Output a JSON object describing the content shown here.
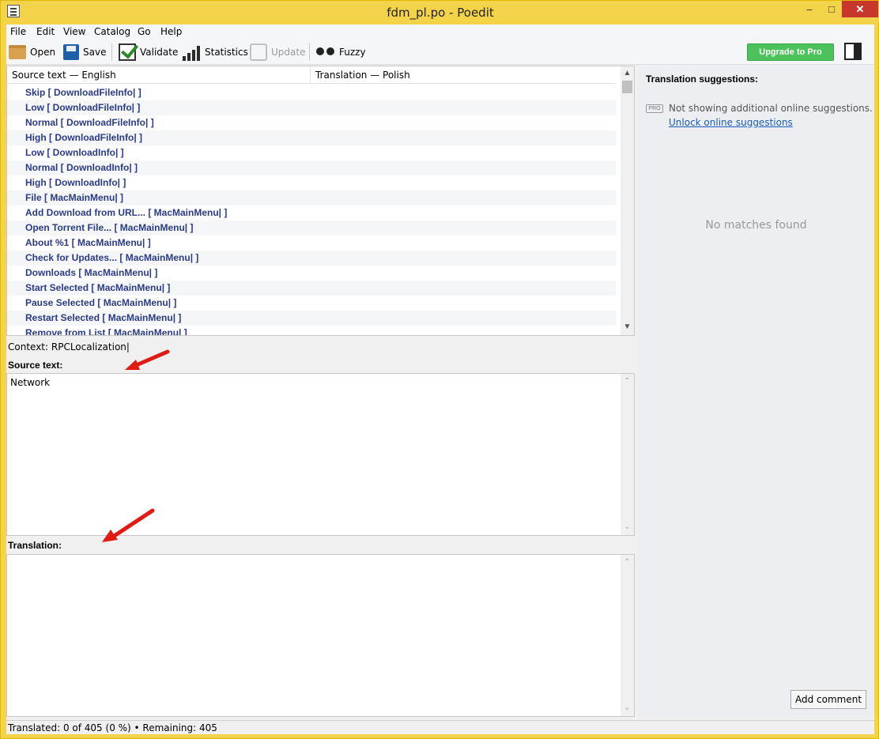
{
  "window": {
    "title": "fdm_pl.po - Poedit"
  },
  "menu": [
    "File",
    "Edit",
    "View",
    "Catalog",
    "Go",
    "Help"
  ],
  "toolbar": {
    "open": "Open",
    "save": "Save",
    "validate": "Validate",
    "statistics": "Statistics",
    "update": "Update",
    "fuzzy": "Fuzzy",
    "upgrade": "Upgrade to Pro"
  },
  "list": {
    "col_source": "Source text — English",
    "col_translation": "Translation — Polish",
    "rows": [
      "Skip  [ DownloadFileInfo| ]",
      "Low  [ DownloadFileInfo| ]",
      "Normal  [ DownloadFileInfo| ]",
      "High  [ DownloadFileInfo| ]",
      "Low  [ DownloadInfo| ]",
      "Normal  [ DownloadInfo| ]",
      "High  [ DownloadInfo| ]",
      "File  [ MacMainMenu| ]",
      "Add Download from URL...  [ MacMainMenu| ]",
      "Open Torrent File...  [ MacMainMenu| ]",
      "About %1  [ MacMainMenu| ]",
      "Check for Updates...  [ MacMainMenu| ]",
      "Downloads  [ MacMainMenu| ]",
      "Start Selected  [ MacMainMenu| ]",
      "Pause Selected  [ MacMainMenu| ]",
      "Restart Selected  [ MacMainMenu| ]",
      "Remove from List  [ MacMainMenu| ]"
    ]
  },
  "editor": {
    "context": "Context: RPCLocalization|",
    "source_label": "Source text:",
    "source_value": "Network",
    "translation_label": "Translation:",
    "translation_value": ""
  },
  "suggestions": {
    "title": "Translation suggestions:",
    "pro_badge": "PRO",
    "note": "Not showing additional online suggestions.",
    "unlock_link": "Unlock online suggestions",
    "empty": "No matches found",
    "add_comment": "Add comment"
  },
  "status": {
    "text": "Translated: 0 of 405 (0 %)  •  Remaining: 405"
  },
  "colors": {
    "accent_green": "#4cc35a",
    "title_bar": "#f2d34a",
    "entry_text": "#2b3b8a",
    "annotation_arrow": "#e01b14"
  }
}
